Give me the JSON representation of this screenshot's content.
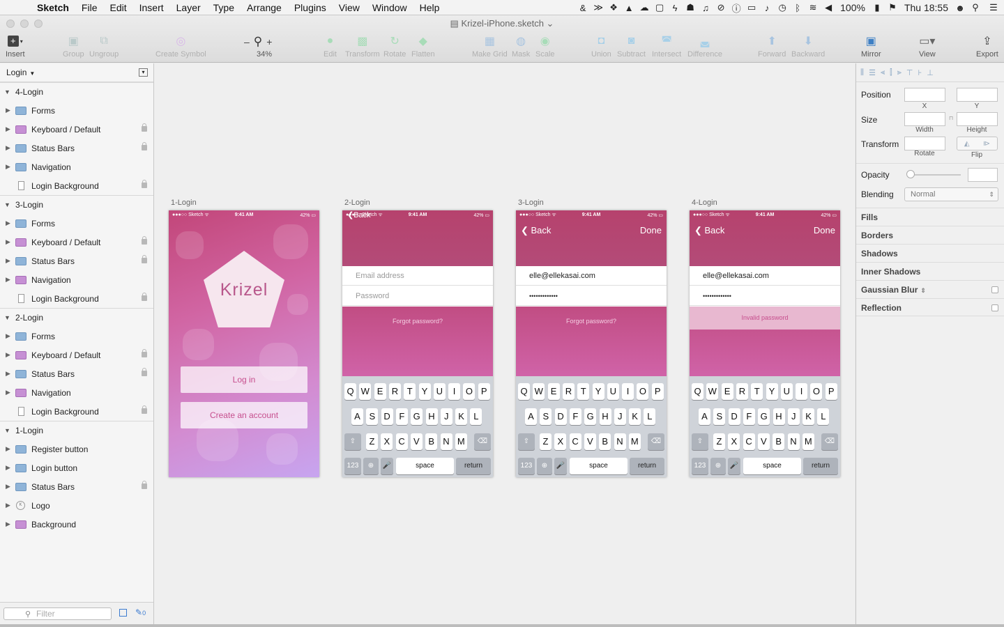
{
  "menubar": {
    "app": "Sketch",
    "items": [
      "File",
      "Edit",
      "Insert",
      "Layer",
      "Type",
      "Arrange",
      "Plugins",
      "View",
      "Window",
      "Help"
    ],
    "battery": "100%",
    "clock": "Thu 18:55"
  },
  "window": {
    "title": "Krizel-iPhone.sketch"
  },
  "toolbar": {
    "insert": "Insert",
    "group": "Group",
    "ungroup": "Ungroup",
    "create_symbol": "Create Symbol",
    "zoom_minus": "–",
    "zoom_plus": "+",
    "zoom_level": "34%",
    "edit": "Edit",
    "transform": "Transform",
    "rotate": "Rotate",
    "flatten": "Flatten",
    "make_grid": "Make Grid",
    "mask": "Mask",
    "scale": "Scale",
    "union": "Union",
    "subtract": "Subtract",
    "intersect": "Intersect",
    "difference": "Difference",
    "forward": "Forward",
    "backward": "Backward",
    "mirror": "Mirror",
    "view": "View",
    "export": "Export"
  },
  "sidebar": {
    "page": "Login",
    "artboards": [
      {
        "name": "4-Login",
        "layers": [
          {
            "name": "Forms",
            "type": "folder-blue",
            "locked": false
          },
          {
            "name": "Keyboard / Default",
            "type": "folder-purple",
            "locked": true
          },
          {
            "name": "Status Bars",
            "type": "folder-blue",
            "locked": true
          },
          {
            "name": "Navigation",
            "type": "folder-blue",
            "locked": false
          },
          {
            "name": "Login Background",
            "type": "rect",
            "locked": true
          }
        ]
      },
      {
        "name": "3-Login",
        "layers": [
          {
            "name": "Forms",
            "type": "folder-blue",
            "locked": false
          },
          {
            "name": "Keyboard / Default",
            "type": "folder-purple",
            "locked": true
          },
          {
            "name": "Status Bars",
            "type": "folder-blue",
            "locked": true
          },
          {
            "name": "Navigation",
            "type": "folder-purple",
            "locked": false
          },
          {
            "name": "Login Background",
            "type": "rect",
            "locked": true
          }
        ]
      },
      {
        "name": "2-Login",
        "layers": [
          {
            "name": "Forms",
            "type": "folder-blue",
            "locked": false
          },
          {
            "name": "Keyboard / Default",
            "type": "folder-purple",
            "locked": true
          },
          {
            "name": "Status Bars",
            "type": "folder-blue",
            "locked": true
          },
          {
            "name": "Navigation",
            "type": "folder-purple",
            "locked": false
          },
          {
            "name": "Login Background",
            "type": "rect",
            "locked": true
          }
        ]
      },
      {
        "name": "1-Login",
        "layers": [
          {
            "name": "Register button",
            "type": "folder-blue",
            "locked": false
          },
          {
            "name": "Login button",
            "type": "folder-blue",
            "locked": false
          },
          {
            "name": "Status Bars",
            "type": "folder-blue",
            "locked": true
          },
          {
            "name": "Logo",
            "type": "logo",
            "locked": false
          },
          {
            "name": "Background",
            "type": "folder-purple",
            "locked": false
          }
        ]
      }
    ],
    "filter_placeholder": "Filter",
    "filter_count": "0"
  },
  "canvas": {
    "status": {
      "carrier": "●●●○○ Sketch ᯤ",
      "time": "9:41 AM",
      "battery": "42% ▭"
    },
    "ab1": {
      "title": "1-Login",
      "logo": "Krizel",
      "login": "Log in",
      "create": "Create an account"
    },
    "ab2": {
      "title": "2-Login",
      "back": "Back",
      "email_ph": "Email address",
      "password_ph": "Password",
      "forgot": "Forgot password?"
    },
    "ab3": {
      "title": "3-Login",
      "back": "Back",
      "done": "Done",
      "email": "elle@ellekasai.com",
      "password": "•••••••••••••",
      "forgot": "Forgot password?"
    },
    "ab4": {
      "title": "4-Login",
      "back": "Back",
      "done": "Done",
      "email": "elle@ellekasai.com",
      "password": "•••••••••••••",
      "error": "Invalid password"
    },
    "keyboard": {
      "row1": [
        "Q",
        "W",
        "E",
        "R",
        "T",
        "Y",
        "U",
        "I",
        "O",
        "P"
      ],
      "row2": [
        "A",
        "S",
        "D",
        "F",
        "G",
        "H",
        "J",
        "K",
        "L"
      ],
      "row3": [
        "Z",
        "X",
        "C",
        "V",
        "B",
        "N",
        "M"
      ],
      "num": "123",
      "space": "space",
      "return": "return"
    }
  },
  "inspector": {
    "position": "Position",
    "x": "X",
    "y": "Y",
    "size": "Size",
    "width": "Width",
    "height": "Height",
    "transform": "Transform",
    "rotate": "Rotate",
    "flip": "Flip",
    "opacity": "Opacity",
    "blending": "Blending",
    "blending_value": "Normal",
    "sections": [
      "Fills",
      "Borders",
      "Shadows",
      "Inner Shadows",
      "Gaussian Blur",
      "Reflection"
    ]
  }
}
